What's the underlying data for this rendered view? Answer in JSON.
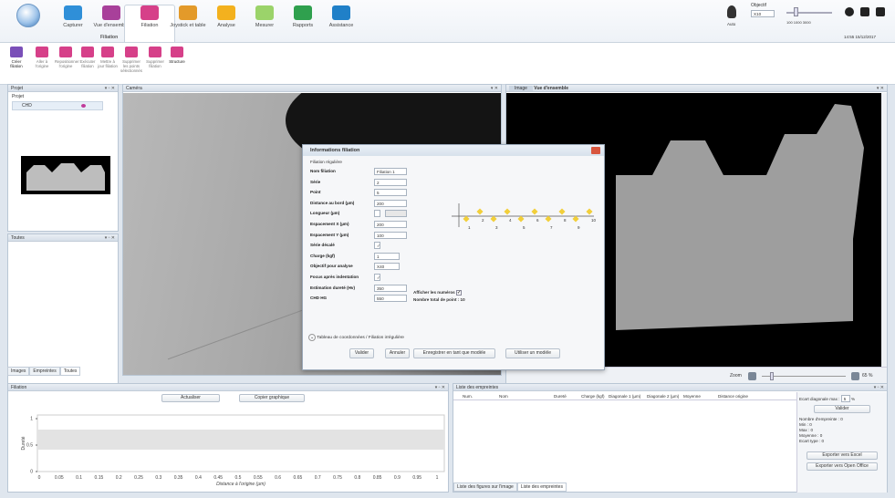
{
  "ribbon": {
    "tabs": [
      {
        "label": "Capturer",
        "color": "#2f8fd8"
      },
      {
        "label": "Vue d'ensemble",
        "color": "#a8409a"
      },
      {
        "label": "Filiation",
        "color": "#d64089"
      },
      {
        "label": "Joystick et table",
        "color": "#e39a2a"
      },
      {
        "label": "Analyse",
        "color": "#f3b11e"
      },
      {
        "label": "Mesurer",
        "color": "#9bd36a"
      },
      {
        "label": "Rapports",
        "color": "#2fa04e"
      },
      {
        "label": "Assistance",
        "color": "#2080c8"
      }
    ],
    "tools": [
      "Créer filiation",
      "Aller à l'origine",
      "Repositionner l'origine",
      "Exécuter filiation",
      "Mettre à jour filiation",
      "Supprimer les points sélectionnés",
      "Supprimer filiation",
      "Structure"
    ],
    "group_label": "Filiation",
    "objective_label": "Objectif",
    "objective_value": "X10",
    "auto_label": "Auto",
    "scale_marks": "100 1000 3000",
    "datetime": "14:55 15/12/2017"
  },
  "left": {
    "project_title": "Projet",
    "tree_root": "Projet",
    "tree_item": "CHD",
    "list_title": "Toutes",
    "tabs": [
      "Images",
      "Empreintes",
      "Toutes"
    ]
  },
  "camera": {
    "title": "Caméra"
  },
  "right": {
    "tabs": [
      "Image",
      "Vue d'ensemble"
    ],
    "zoom_label": "Zoom",
    "zoom_value": "65 %"
  },
  "dialog": {
    "title": "Informations filiation",
    "subtitle": "Filiation régulière",
    "fields": [
      {
        "label": "Nom filiation",
        "value": "Filiation 1"
      },
      {
        "label": "Série",
        "value": "2"
      },
      {
        "label": "Point",
        "value": "5"
      },
      {
        "label": "Distance au bord (µm)",
        "value": "200"
      },
      {
        "label": "Longueur (µm)",
        "value": ""
      },
      {
        "label": "Espacement X (µm)",
        "value": "200"
      },
      {
        "label": "Espacement Y (µm)",
        "value": "100"
      },
      {
        "label": "Série décalé",
        "value": ""
      },
      {
        "label": "Charge (kgf)",
        "value": "1"
      },
      {
        "label": "Objectif pour analyse",
        "value": "X40"
      },
      {
        "label": "Focus après indentation",
        "value": ""
      },
      {
        "label": "Estimation dureté (Hv)",
        "value": "350"
      },
      {
        "label": "CHD HG",
        "value": "550"
      }
    ],
    "show_numbers": "Afficher les numéros",
    "total_points": "Nombre total de point : 10",
    "diagram_numbers": [
      "1",
      "2",
      "3",
      "4",
      "5",
      "6",
      "7",
      "8",
      "9",
      "10"
    ],
    "table_link": "Tableau de coordonnées / Filiation irrégulière",
    "buttons": [
      "Valider",
      "Annuler",
      "Enregistrer en tant que modèle",
      "Utiliser un modèle"
    ]
  },
  "filiation_panel": {
    "title": "Filiation",
    "buttons": [
      "Actualiser",
      "Copier graphique"
    ],
    "ylabel": "Dureté",
    "xlabel": "Distance à l'origine (µm)"
  },
  "chart_data": {
    "type": "line",
    "x_ticks": [
      "0",
      "0.05",
      "0.1",
      "0.15",
      "0.2",
      "0.25",
      "0.3",
      "0.35",
      "0.4",
      "0.45",
      "0.5",
      "0.55",
      "0.6",
      "0.65",
      "0.7",
      "0.75",
      "0.8",
      "0.85",
      "0.9",
      "0.95",
      "1"
    ],
    "y_ticks": [
      "0",
      "0.5",
      "1"
    ],
    "xlabel": "Distance à l'origine (µm)",
    "ylabel": "Dureté",
    "series": []
  },
  "empreintes": {
    "title": "Liste des empreintes",
    "columns": [
      "Num.",
      "Nom",
      "Dureté",
      "Charge (kgf)",
      "Diagonale 1 (µm)",
      "Diagonale 2 (µm)",
      "Moyenne",
      "Distance origine"
    ],
    "ecart_label": "Ecart diagonale max :",
    "ecart_value": "5",
    "ecart_unit": "%",
    "valider": "Valider",
    "stats": [
      "Nombre d'empreinte : 0",
      "Min : 0",
      "Max : 0",
      "Moyenne : 0",
      "Ecart type : 0"
    ],
    "export_excel": "Exporter vers Excel",
    "export_oo": "Exporter vers Open Office",
    "tabs": [
      "Liste des figures sur l'image",
      "Liste des empreintes"
    ]
  }
}
